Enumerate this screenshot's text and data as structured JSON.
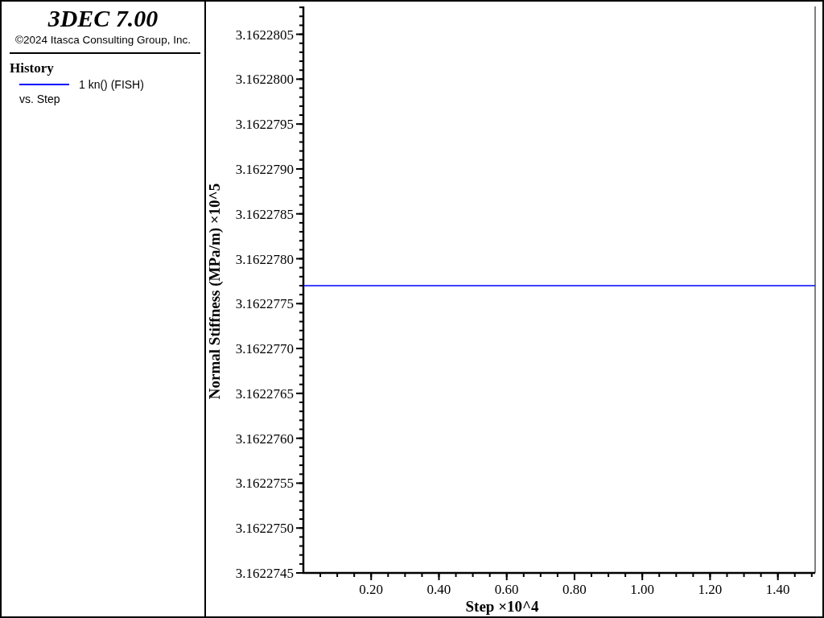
{
  "title_panel": {
    "product": "3DEC 7.00",
    "copyright": "©2024 Itasca Consulting Group, Inc."
  },
  "legend": {
    "heading": "History",
    "items": [
      {
        "label": "1 kn() (FISH)",
        "color": "#0000ff"
      }
    ],
    "footnote": "vs. Step"
  },
  "plot": {
    "chart_data": {
      "type": "line",
      "xlabel": "Step ×10^4",
      "ylabel": "Normal Stiffness (MPa/m) ×10^5",
      "x": [
        0,
        1.51
      ],
      "series": [
        {
          "color": "#0000ff",
          "values": [
            3.1622777,
            3.1622777
          ]
        }
      ],
      "xlim": [
        0,
        1.51
      ],
      "ylim": [
        3.1622745,
        3.16228081
      ],
      "xticks": [
        {
          "value": 0.2,
          "label": "0.20"
        },
        {
          "value": 0.4,
          "label": "0.40"
        },
        {
          "value": 0.6,
          "label": "0.60"
        },
        {
          "value": 0.8,
          "label": "0.80"
        },
        {
          "value": 1.0,
          "label": "1.00"
        },
        {
          "value": 1.2,
          "label": "1.20"
        },
        {
          "value": 1.4,
          "label": "1.40"
        }
      ],
      "yticks": [
        {
          "value": 3.1622745,
          "label": "3.1622745"
        },
        {
          "value": 3.162275,
          "label": "3.1622750"
        },
        {
          "value": 3.1622755,
          "label": "3.1622755"
        },
        {
          "value": 3.162276,
          "label": "3.1622760"
        },
        {
          "value": 3.1622765,
          "label": "3.1622765"
        },
        {
          "value": 3.162277,
          "label": "3.1622770"
        },
        {
          "value": 3.1622775,
          "label": "3.1622775"
        },
        {
          "value": 3.162278,
          "label": "3.1622780"
        },
        {
          "value": 3.1622785,
          "label": "3.1622785"
        },
        {
          "value": 3.162279,
          "label": "3.1622790"
        },
        {
          "value": 3.1622795,
          "label": "3.1622795"
        },
        {
          "value": 3.16228,
          "label": "3.1622800"
        },
        {
          "value": 3.1622805,
          "label": "3.1622805"
        }
      ]
    }
  }
}
